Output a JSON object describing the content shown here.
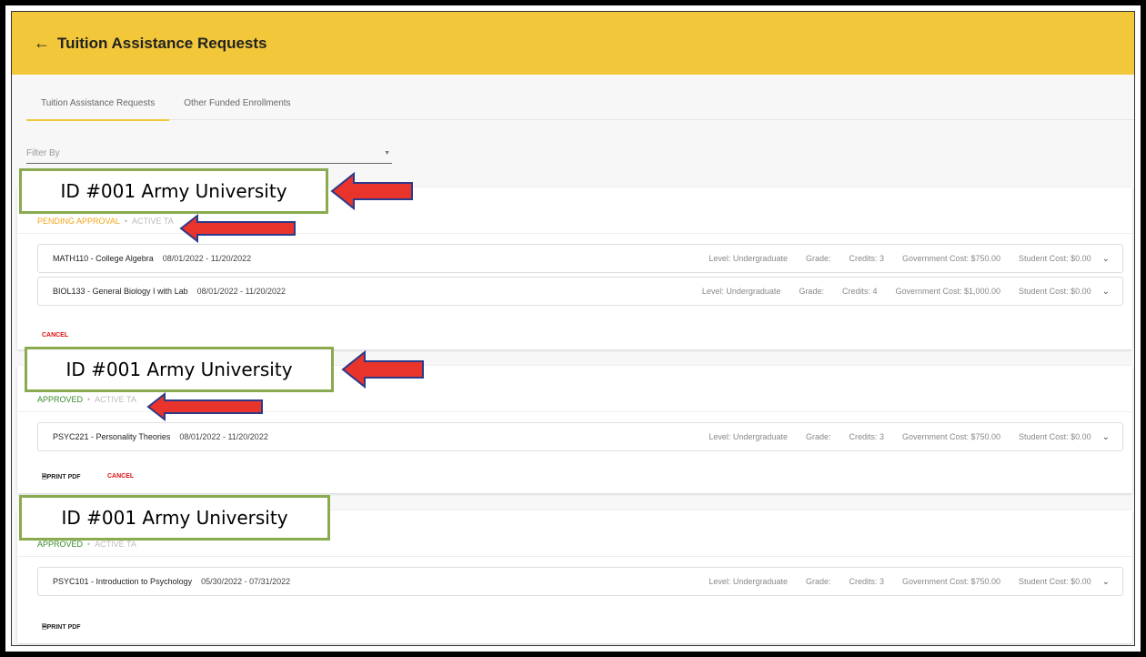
{
  "header": {
    "back_icon": "arrow-left-icon",
    "title": "Tuition Assistance Requests"
  },
  "tabs": [
    {
      "label": "Tuition Assistance Requests",
      "active": true
    },
    {
      "label": "Other Funded Enrollments",
      "active": false
    }
  ],
  "filter": {
    "placeholder": "Filter By"
  },
  "annotation_label": "ID #001 Army University",
  "requests": [
    {
      "status": "PENDING APPROVAL",
      "type": "ACTIVE TA",
      "courses": [
        {
          "name": "MATH110 - College Algebra",
          "dates": "08/01/2022 - 11/20/2022",
          "level": "Level: Undergraduate",
          "grade": "Grade:",
          "credits": "Credits: 3",
          "gov_cost": "Government Cost: $750.00",
          "student_cost": "Student Cost: $0.00"
        },
        {
          "name": "BIOL133 - General Biology I with Lab",
          "dates": "08/01/2022 - 11/20/2022",
          "level": "Level: Undergraduate",
          "grade": "Grade:",
          "credits": "Credits: 4",
          "gov_cost": "Government Cost: $1,000.00",
          "student_cost": "Student Cost: $0.00"
        }
      ],
      "actions": {
        "cancel": "CANCEL"
      }
    },
    {
      "status": "APPROVED",
      "type": "ACTIVE TA",
      "courses": [
        {
          "name": "PSYC221 - Personality Theories",
          "dates": "08/01/2022 - 11/20/2022",
          "level": "Level: Undergraduate",
          "grade": "Grade:",
          "credits": "Credits: 3",
          "gov_cost": "Government Cost: $750.00",
          "student_cost": "Student Cost: $0.00"
        }
      ],
      "actions": {
        "print": "PRINT PDF",
        "cancel": "CANCEL"
      }
    },
    {
      "status": "APPROVED",
      "type": "ACTIVE TA",
      "courses": [
        {
          "name": "PSYC101 - Introduction to Psychology",
          "dates": "05/30/2022 - 07/31/2022",
          "level": "Level: Undergraduate",
          "grade": "Grade:",
          "credits": "Credits: 3",
          "gov_cost": "Government Cost: $750.00",
          "student_cost": "Student Cost: $0.00"
        }
      ],
      "actions": {
        "print": "PRINT PDF"
      }
    }
  ],
  "colors": {
    "header": "#f2c83a",
    "pending": "#f2a51a",
    "approved": "#3a8a2e",
    "cancel": "#dd1111",
    "annotation_border": "#8aaa50",
    "arrow_fill": "#e8342a",
    "arrow_stroke": "#2b3a8a"
  }
}
